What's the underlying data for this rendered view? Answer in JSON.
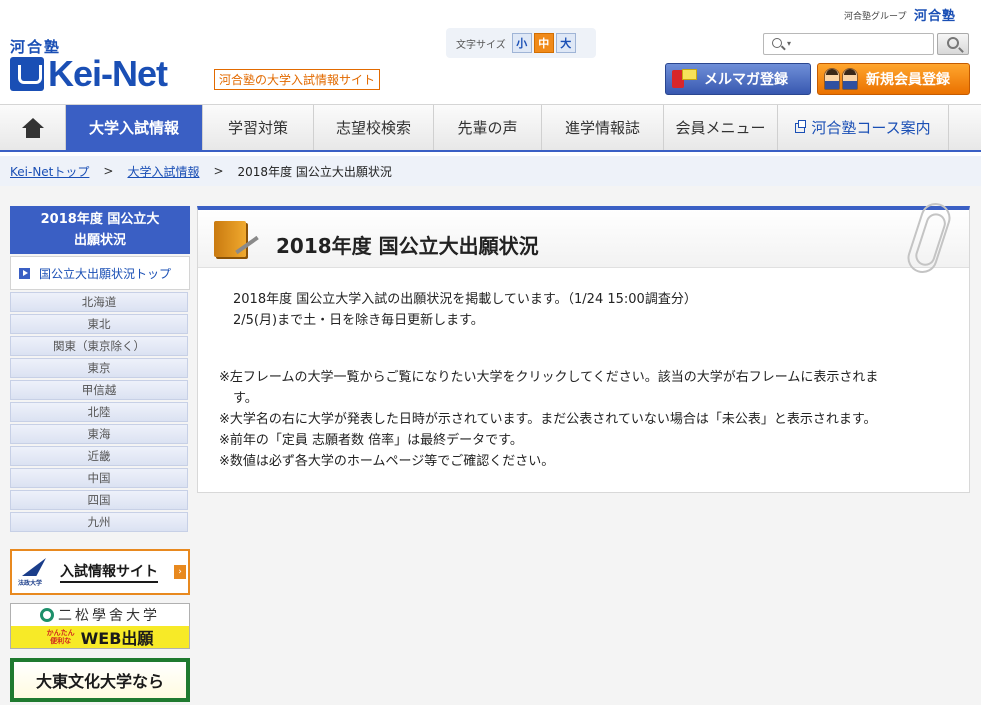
{
  "top": {
    "group_label": "河合塾グループ",
    "group_logo": "河合塾"
  },
  "header": {
    "kawai_label": "河合塾",
    "logo_text": "Kei-Net",
    "tagline": "河合塾の大学入試情報サイト",
    "fontsize": {
      "label": "文字サイズ",
      "options": [
        "小",
        "中",
        "大"
      ],
      "selected": "中"
    },
    "search": {
      "placeholder": "",
      "icon": "search-icon"
    },
    "mail_button": "メルマガ登録",
    "register_button": "新規会員登録"
  },
  "nav": {
    "home_icon": "home-icon",
    "items": [
      {
        "label": "大学入試情報"
      },
      {
        "label": "学習対策"
      },
      {
        "label": "志望校検索"
      },
      {
        "label": "先輩の声"
      },
      {
        "label": "進学情報誌"
      },
      {
        "label": "会員メニュー"
      },
      {
        "label": "河合塾コース案内"
      }
    ],
    "active": "大学入試情報"
  },
  "breadcrumb": {
    "items": [
      "Kei-Netトップ",
      "大学入試情報",
      "2018年度 国公立大出願状況"
    ],
    "separator": ">"
  },
  "sidebar": {
    "heading": [
      "2018年度 国公立大",
      "出願状況"
    ],
    "top_link": "国公立大出願状況トップ",
    "regions": [
      "北海道",
      "東北",
      "関東（東京除く）",
      "東京",
      "甲信越",
      "北陸",
      "東海",
      "近畿",
      "中国",
      "四国",
      "九州"
    ],
    "ads": {
      "hosei_logo": "法政大学",
      "hosei_text": "入試情報サイト",
      "nisho_name": "二松學舍大学",
      "nisho_sub": [
        "かんたん",
        "便利な"
      ],
      "nisho_web": "WEB出願",
      "daito_text": "大東文化大学なら"
    }
  },
  "content": {
    "title": "2018年度 国公立大出願状況",
    "paragraph1": [
      "2018年度 国公立大学入試の出願状況を掲載しています。（1/24 15:00調査分）",
      "2/5(月)まで土・日を除き毎日更新します。"
    ],
    "notes": [
      "※左フレームの大学一覧からご覧になりたい大学をクリックしてください。該当の大学が右フレームに表示されま",
      "す。",
      "※大学名の右に大学が発表した日時が示されています。まだ公表されていない場合は「未公表」と表示されます。",
      "※前年の「定員 志願者数 倍率」は最終データです。",
      "※数値は必ず各大学のホームページ等でご確認ください。"
    ]
  },
  "colors": {
    "brand_blue": "#3a5fc4",
    "accent_orange": "#f08a1a"
  }
}
